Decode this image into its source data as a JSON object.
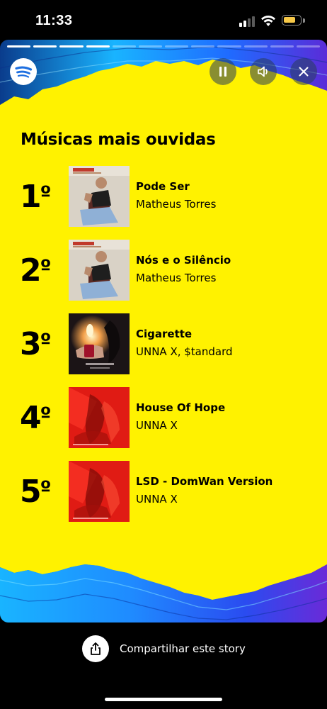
{
  "status_bar": {
    "time": "11:33",
    "battery_color": "#f7c948",
    "battery_level": 0.75
  },
  "story": {
    "segments_total": 12,
    "segments_done": 4,
    "title": "Músicas mais ouvidas",
    "background_color": "#fff200",
    "controls": {
      "pause": "pause-icon",
      "volume": "volume-icon",
      "close": "close-icon"
    },
    "tracks": [
      {
        "rank": "1",
        "ordinal": "º",
        "name": "Pode Ser",
        "artist": "Matheus Torres"
      },
      {
        "rank": "2",
        "ordinal": "º",
        "name": "Nós e o Silêncio",
        "artist": "Matheus Torres"
      },
      {
        "rank": "3",
        "ordinal": "º",
        "name": "Cigarette",
        "artist": "UNNA X, $tandard"
      },
      {
        "rank": "4",
        "ordinal": "º",
        "name": "House Of Hope",
        "artist": "UNNA X"
      },
      {
        "rank": "5",
        "ordinal": "º",
        "name": "LSD - DomWan Version",
        "artist": "UNNA X"
      }
    ]
  },
  "share": {
    "label": "Compartilhar este story",
    "icon": "share-icon"
  }
}
